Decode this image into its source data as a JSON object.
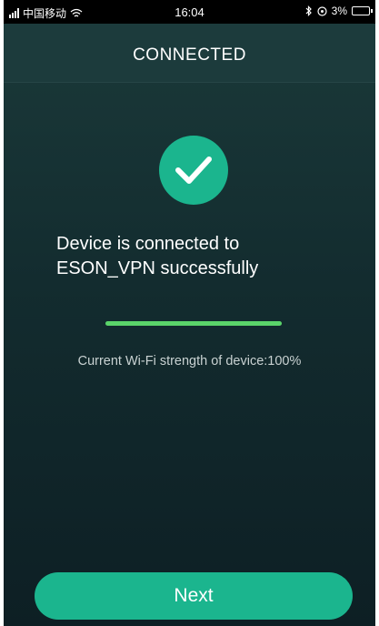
{
  "status_bar": {
    "carrier": "中国移动",
    "time": "16:04",
    "battery_percent": "3%"
  },
  "header": {
    "title": "CONNECTED"
  },
  "main": {
    "icon": "check-icon",
    "message_line1": "Device is connected to",
    "message_line2": "ESON_VPN successfully",
    "progress": 1.0,
    "wifi_strength_text": "Current Wi-Fi strength of device:100%"
  },
  "footer": {
    "next_label": "Next"
  },
  "colors": {
    "accent": "#1bb58e",
    "progress": "#5ad46a",
    "background_top": "#1b3a3a",
    "background_bottom": "#0d1f24"
  }
}
